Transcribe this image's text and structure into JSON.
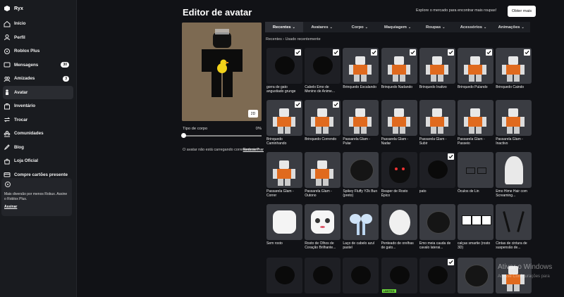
{
  "user": {
    "name": "Ryx"
  },
  "sidebar": {
    "items": [
      {
        "label": "Início",
        "icon": "home-icon"
      },
      {
        "label": "Perfil",
        "icon": "profile-icon"
      },
      {
        "label": "Roblox Plus",
        "icon": "plus-icon"
      },
      {
        "label": "Mensagens",
        "icon": "messages-icon",
        "badge": "30"
      },
      {
        "label": "Amizades",
        "icon": "friends-icon",
        "badge": "3"
      },
      {
        "label": "Avatar",
        "icon": "avatar-icon",
        "active": true
      },
      {
        "label": "Inventário",
        "icon": "inventory-icon"
      },
      {
        "label": "Trocar",
        "icon": "trade-icon"
      },
      {
        "label": "Comunidades",
        "icon": "communities-icon"
      },
      {
        "label": "Blog",
        "icon": "blog-icon"
      },
      {
        "label": "Loja Oficial",
        "icon": "store-icon"
      },
      {
        "label": "Compre cartões presente",
        "icon": "gift-card-icon"
      }
    ],
    "promo": {
      "text": "Mais diversão por menos Robux. Assine o Roblox Plus.",
      "link": "Assinar"
    }
  },
  "header": {
    "title": "Editor de avatar",
    "explore": "Explore o mercado para encontrar mais roupas!",
    "more_button": "Obter mais"
  },
  "preview": {
    "toggle_label": "2D",
    "body_type_label": "Tipo de corpo",
    "body_type_value": "0%",
    "body_type_fraction": 0,
    "warning": "O avatar não está carregando corretamente?",
    "redraw": "Redesenhar"
  },
  "tabs": [
    "Recentes",
    "Avatares",
    "Corpo",
    "Maquiagem",
    "Roupas",
    "Acessórios",
    "Animações"
  ],
  "breadcrumb": "Recentes  ›  Usado recentemente",
  "items": [
    {
      "name": "gorra de gato angustiado grunge",
      "checked": true,
      "kind": "dark"
    },
    {
      "name": "Cabelo Emo de Menino de Anime...",
      "checked": true,
      "kind": "dark"
    },
    {
      "name": "Brinquedo Escalando",
      "checked": true,
      "kind": "anim"
    },
    {
      "name": "Brinquedo Nadando",
      "checked": true,
      "kind": "anim"
    },
    {
      "name": "Brinquedo Inativo",
      "checked": true,
      "kind": "anim"
    },
    {
      "name": "Brinquedo Pulando",
      "checked": true,
      "kind": "anim"
    },
    {
      "name": "Brinquedo Caindo",
      "checked": true,
      "kind": "anim"
    },
    {
      "name": "Brinquedo Caminhando",
      "checked": true,
      "kind": "anim"
    },
    {
      "name": "Brinquedo Correndo",
      "checked": true,
      "kind": "anim"
    },
    {
      "name": "Passarela Glam - Pular",
      "checked": false,
      "kind": "anim"
    },
    {
      "name": "Passarela Glam - Nadar",
      "checked": false,
      "kind": "anim"
    },
    {
      "name": "Passarela Glam - Subir",
      "checked": false,
      "kind": "anim"
    },
    {
      "name": "Passarela Glam - Passeio",
      "checked": false,
      "kind": "anim"
    },
    {
      "name": "Passarela Glam - Inactivo",
      "checked": false,
      "kind": "anim"
    },
    {
      "name": "Passarela Glam - Correr",
      "checked": false,
      "kind": "anim"
    },
    {
      "name": "Passarela Glam - Outono",
      "checked": false,
      "kind": "anim"
    },
    {
      "name": "Spikey Fluffy Y2k Bun (preto)",
      "checked": false,
      "kind": "hair"
    },
    {
      "name": "Reaper de Rosto Épico",
      "checked": false,
      "kind": "hood"
    },
    {
      "name": "pato",
      "checked": true,
      "kind": "dark"
    },
    {
      "name": "Óculos de Lin",
      "checked": false,
      "kind": "glasses"
    },
    {
      "name": "Emo Hime Hair com Screaming...",
      "checked": false,
      "kind": "ghost"
    },
    {
      "name": "Sem rosto",
      "checked": false,
      "kind": "head"
    },
    {
      "name": "Rosto de Olhos de Coração Brilhante...",
      "checked": false,
      "kind": "face"
    },
    {
      "name": "Laço de cabelo azul pastel",
      "checked": false,
      "kind": "bow"
    },
    {
      "name": "Penteado de orelhas de gato...",
      "checked": false,
      "kind": "whitehair"
    },
    {
      "name": "Emo meia cauda de cavalo laterai...",
      "checked": false,
      "kind": "hair"
    },
    {
      "name": "calças smartie (rosto 3D)",
      "checked": false,
      "kind": "pants"
    },
    {
      "name": "Cintas de cintura de suspensão de...",
      "checked": false,
      "kind": "straps"
    },
    {
      "name": "",
      "checked": false,
      "kind": "dark"
    },
    {
      "name": "",
      "checked": false,
      "kind": "dark"
    },
    {
      "name": "",
      "checked": false,
      "kind": "dark"
    },
    {
      "name": "",
      "checked": false,
      "kind": "dark",
      "label": "LIMITED"
    },
    {
      "name": "",
      "checked": true,
      "kind": "dark"
    },
    {
      "name": "",
      "checked": false,
      "kind": "hair"
    },
    {
      "name": "",
      "checked": false,
      "kind": "anim"
    }
  ],
  "watermark": {
    "line1": "Ativar o Windows",
    "line2": "Acesse Configurações para"
  },
  "colors": {
    "accent": "#ffffff",
    "background": "#111216",
    "sidebar": "#191b1f",
    "tile": "#3a3c42",
    "limited": "#6ddc3b"
  }
}
